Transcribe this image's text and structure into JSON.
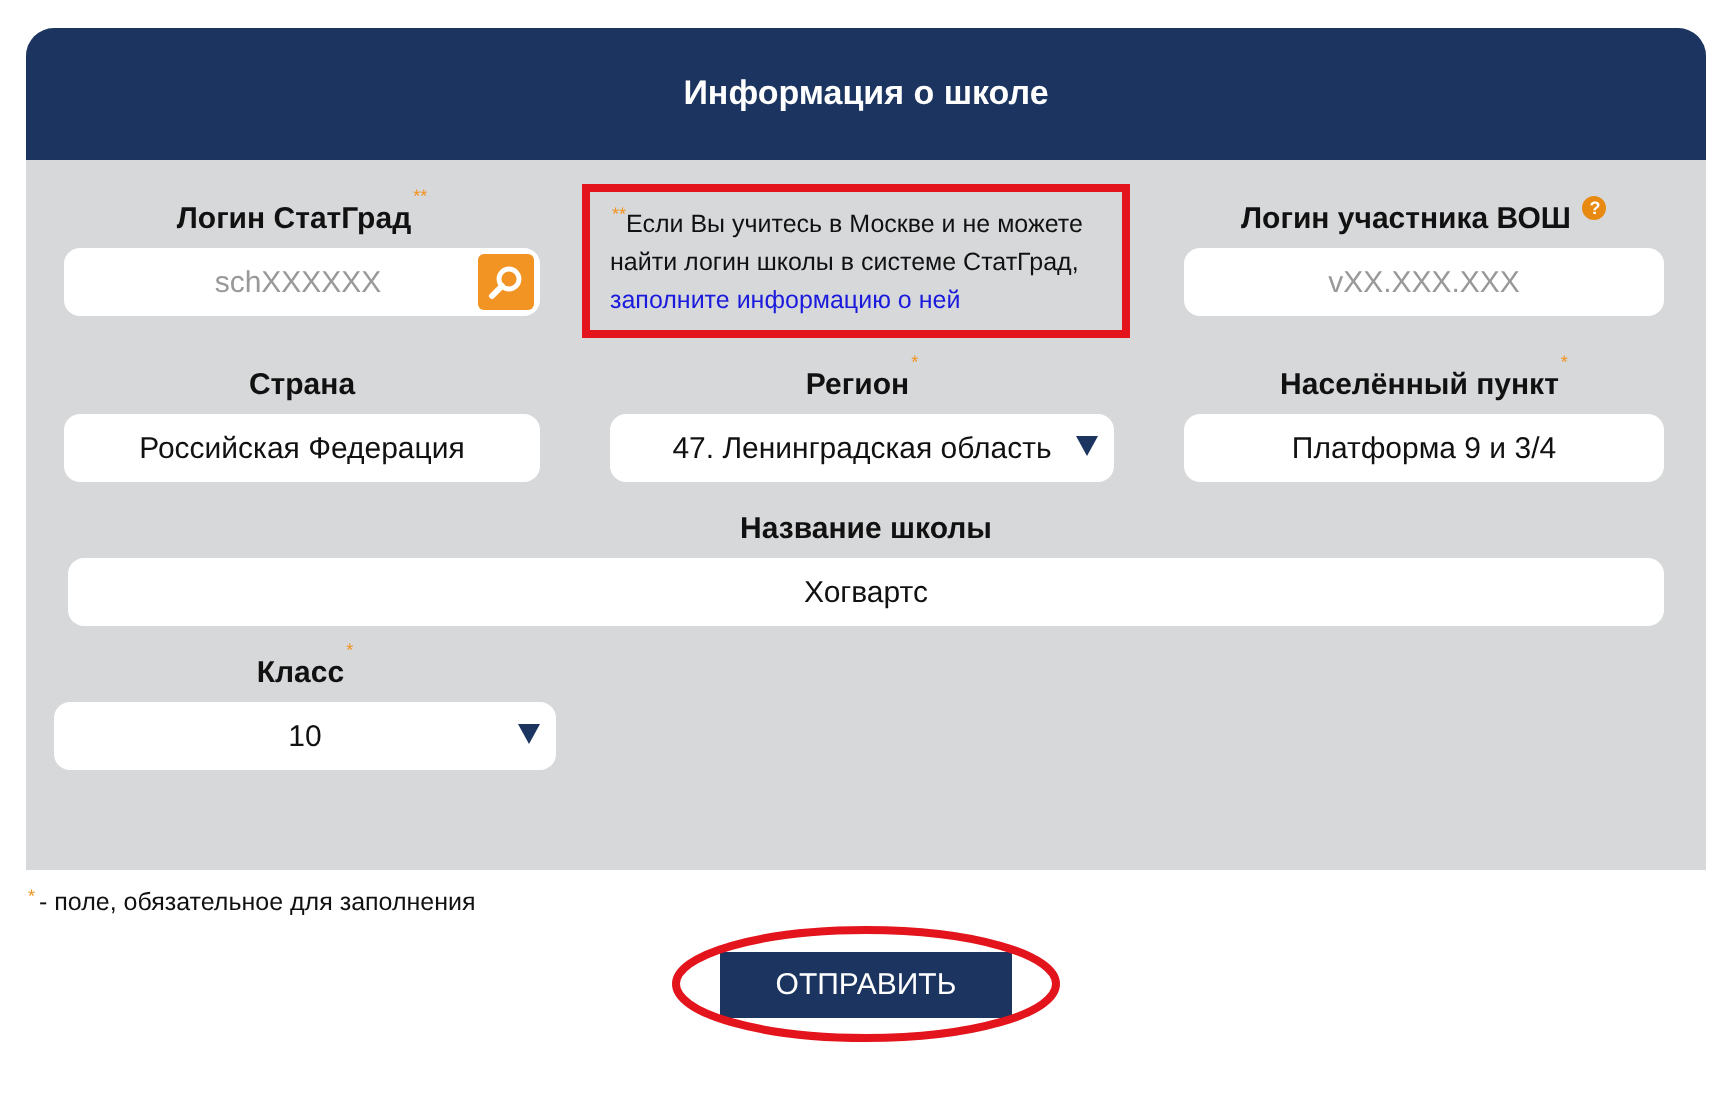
{
  "header": {
    "title": "Информация о школе"
  },
  "fields": [
    {
      "kind": "search",
      "label": "Логин СтатГрад",
      "mark": "**",
      "placeholder": "schXXXXXX"
    },
    {
      "kind": "note",
      "mark": "**",
      "text": "Если Вы учитесь в Москве и не можете найти логин школы в системе СтатГрад,",
      "link": "заполните информацию о ней"
    },
    {
      "kind": "input",
      "label": "Логин участника ВОШ",
      "help": "?",
      "placeholder": "vXX.XXX.XXX"
    },
    {
      "kind": "input",
      "label": "Страна",
      "value": "Российская Федерация"
    },
    {
      "kind": "select",
      "label": "Регион",
      "mark": "*",
      "value": "47. Ленинградская область"
    },
    {
      "kind": "input",
      "label": "Населённый пункт",
      "mark": "*",
      "value": "Платформа 9 и 3/4"
    },
    {
      "kind": "wide",
      "label": "Название школы",
      "value": "Хогвартс"
    },
    {
      "kind": "select",
      "label": "Класс",
      "mark": "*",
      "value": "10"
    }
  ],
  "footnote": {
    "mark": "*",
    "text": "- поле, обязательное для заполнения"
  },
  "submit": {
    "label": "ОТПРАВИТЬ"
  }
}
